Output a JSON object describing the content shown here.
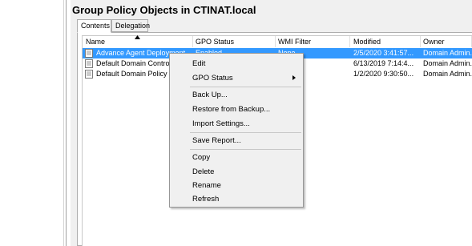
{
  "header": {
    "title": "Group Policy Objects in CTINAT.local"
  },
  "tabs": [
    {
      "label": "Contents",
      "active": true
    },
    {
      "label": "Delegation",
      "active": false
    }
  ],
  "columns": [
    "Name",
    "GPO Status",
    "WMI Filter",
    "Modified",
    "Owner"
  ],
  "rows": [
    {
      "name": "Advance Agent Deployment",
      "status": "Enabled",
      "wmi": "None",
      "modified": "2/5/2020 3:41:57...",
      "owner": "Domain Admin...",
      "selected": true
    },
    {
      "name": "Default Domain Controlle",
      "status": "",
      "wmi": "",
      "modified": "6/13/2019 7:14:4...",
      "owner": "Domain Admin...",
      "selected": false
    },
    {
      "name": "Default Domain Policy",
      "status": "",
      "wmi": "",
      "modified": "1/2/2020 9:30:50...",
      "owner": "Domain Admin...",
      "selected": false
    }
  ],
  "context_menu": {
    "items": [
      {
        "label": "Edit"
      },
      {
        "label": "GPO Status",
        "has_submenu": true
      },
      {
        "label": "Back Up..."
      },
      {
        "label": "Restore from Backup..."
      },
      {
        "label": "Import Settings..."
      },
      {
        "label": "Save Report..."
      },
      {
        "label": "Copy"
      },
      {
        "label": "Delete"
      },
      {
        "label": "Rename"
      },
      {
        "label": "Refresh"
      }
    ]
  },
  "colors": {
    "selection": "#3399ff",
    "menu_bg": "#f0f0f0"
  },
  "icons": {
    "row_icon": "gpo-document-icon",
    "sort": "sort-ascending-icon"
  }
}
